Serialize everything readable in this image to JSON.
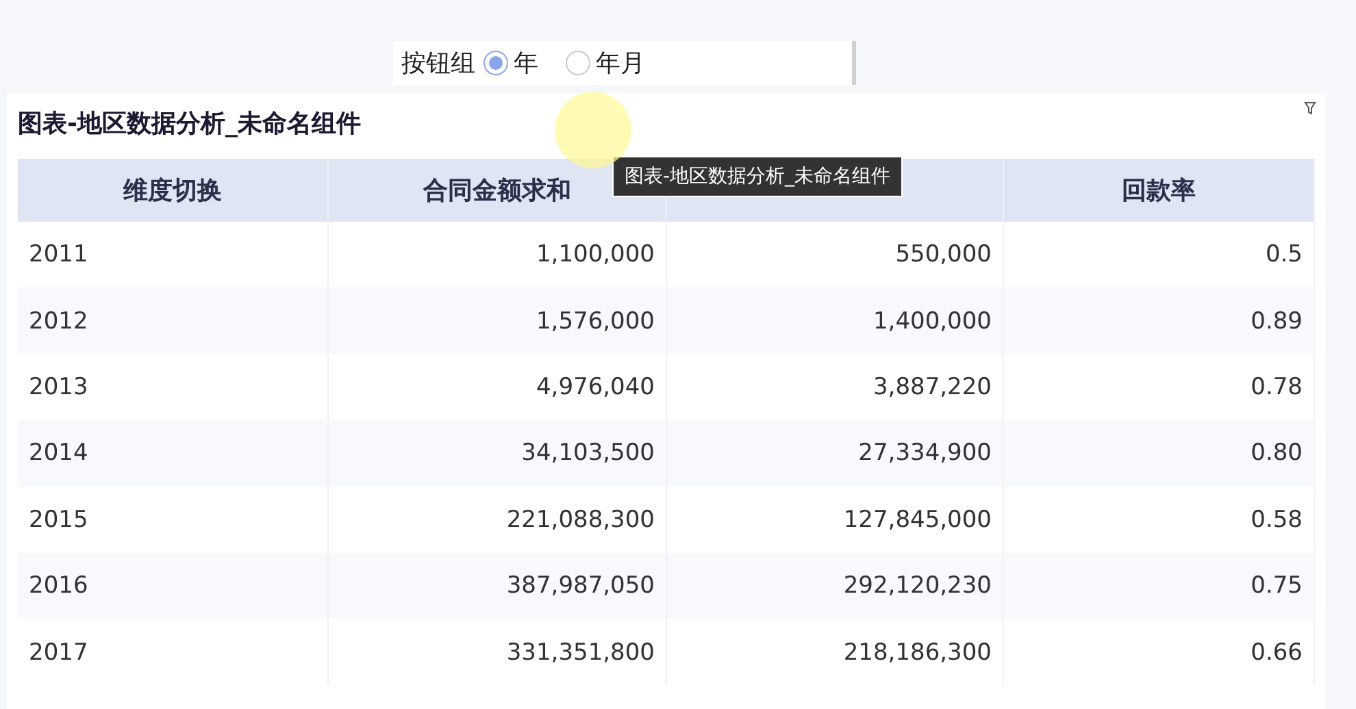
{
  "radio_group": {
    "label": "按钮组",
    "options": [
      {
        "label": "年",
        "selected": true
      },
      {
        "label": "年月",
        "selected": false
      }
    ]
  },
  "card": {
    "title": "图表-地区数据分析_未命名组件",
    "tooltip": "图表-地区数据分析_未命名组件"
  },
  "table": {
    "columns": [
      {
        "label": "维度切换"
      },
      {
        "label": "合同金额求和"
      },
      {},
      {
        "label": "回款率"
      }
    ],
    "rows": [
      [
        "2011",
        "1,100,000",
        "550,000",
        "0.5"
      ],
      [
        "2012",
        "1,576,000",
        "1,400,000",
        "0.89"
      ],
      [
        "2013",
        "4,976,040",
        "3,887,220",
        "0.78"
      ],
      [
        "2014",
        "34,103,500",
        "27,334,900",
        "0.80"
      ],
      [
        "2015",
        "221,088,300",
        "127,845,000",
        "0.58"
      ],
      [
        "2016",
        "387,987,050",
        "292,120,230",
        "0.75"
      ],
      [
        "2017",
        "331,351,800",
        "218,186,300",
        "0.66"
      ]
    ]
  }
}
